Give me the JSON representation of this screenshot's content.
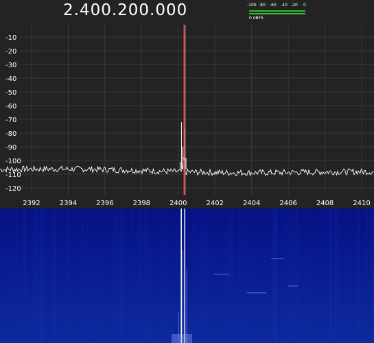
{
  "frequency_display": "2.400.200.000",
  "signal_meter": {
    "scale_labels": [
      "-100",
      "-80",
      "-60",
      "-40",
      "-20",
      "0"
    ],
    "unit_label": "0 dBFS",
    "bar_color": "#2fbf2f"
  },
  "spectrum": {
    "y_ticks": [
      "-10",
      "-20",
      "-30",
      "-40",
      "-50",
      "-60",
      "-70",
      "-80",
      "-90",
      "-100",
      "-110",
      "-120"
    ],
    "x_ticks": [
      "2392",
      "2394",
      "2396",
      "2398",
      "2400",
      "2402",
      "2404",
      "2406",
      "2408",
      "2410"
    ],
    "tuned_marker_color": "#ff6b6b",
    "trace_color": "#ffffff",
    "grid_color": "#3a3a3a",
    "background_color": "#232323"
  },
  "waterfall": {
    "background_color": "#07128f"
  }
}
